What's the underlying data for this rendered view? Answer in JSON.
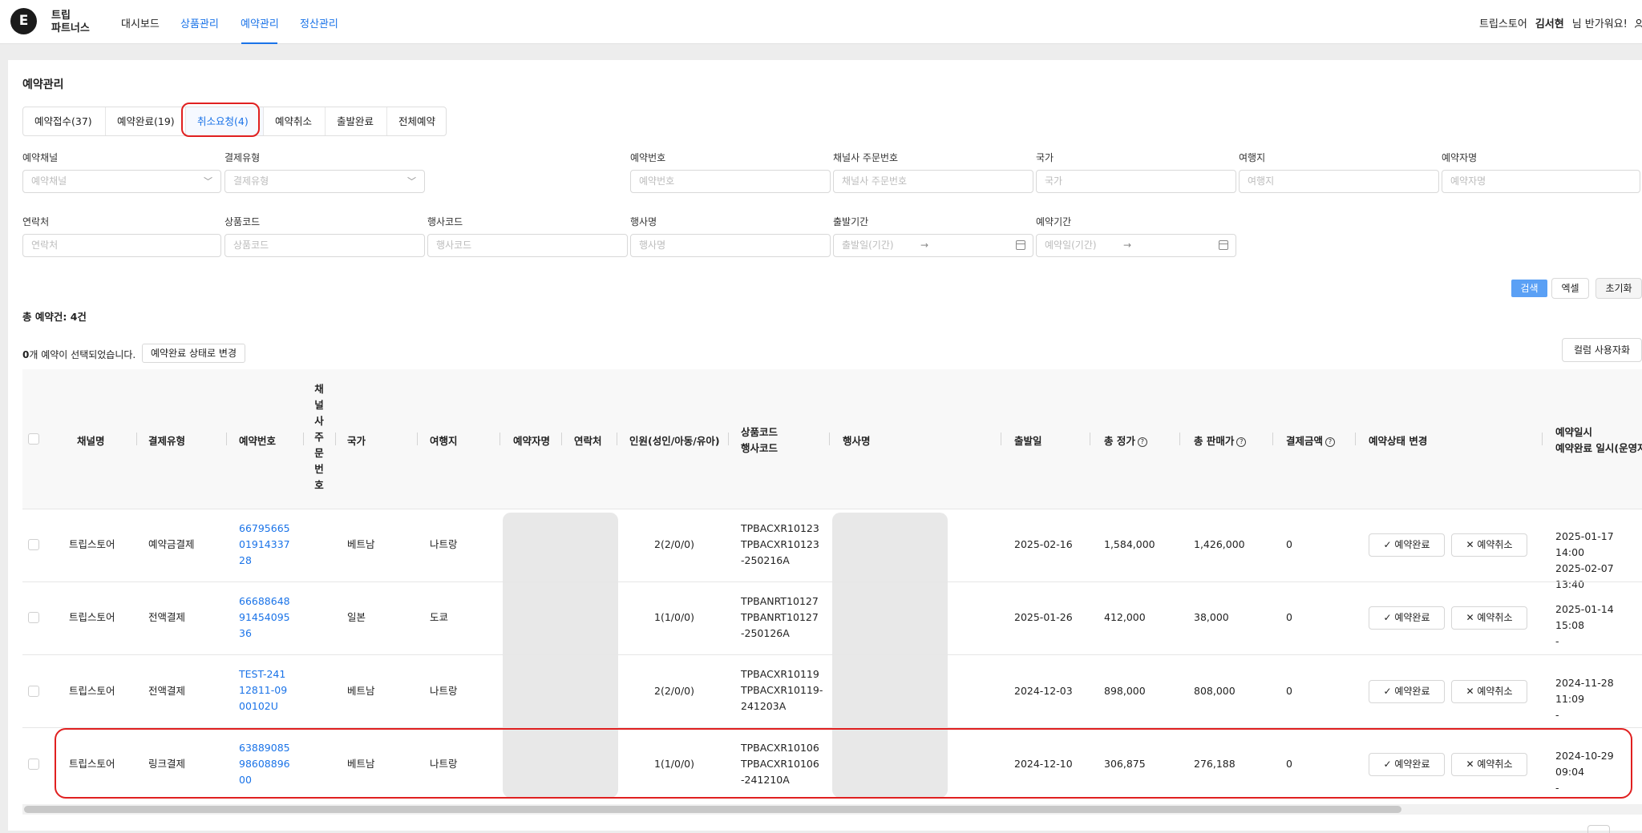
{
  "header": {
    "logo_letter": "E",
    "brand_line1": "트립",
    "brand_line2": "파트너스",
    "nav": [
      "대시보드",
      "상품관리",
      "예약관리",
      "정산관리"
    ],
    "store": "트립스토어",
    "user_name": "김서현",
    "greeting": "님 반가워요!"
  },
  "page": {
    "title": "예약관리",
    "tabs": [
      "예약접수(37)",
      "예약완료(19)",
      "취소요청(4)",
      "예약취소",
      "출발완료",
      "전체예약"
    ]
  },
  "filters": {
    "row1": [
      {
        "label": "예약채널",
        "placeholder": "예약채널"
      },
      {
        "label": "결제유형",
        "placeholder": "결제유형"
      },
      {
        "label": "예약번호",
        "placeholder": "예약번호"
      },
      {
        "label": "채널사 주문번호",
        "placeholder": "채널사 주문번호"
      },
      {
        "label": "국가",
        "placeholder": "국가"
      },
      {
        "label": "여행지",
        "placeholder": "여행지"
      },
      {
        "label": "예약자명",
        "placeholder": "예약자명"
      }
    ],
    "row2": [
      {
        "label": "연락처",
        "placeholder": "연락처"
      },
      {
        "label": "상품코드",
        "placeholder": "상품코드"
      },
      {
        "label": "행사코드",
        "placeholder": "행사코드"
      },
      {
        "label": "행사명",
        "placeholder": "행사명"
      },
      {
        "label": "출발기간",
        "placeholder": "출발일(기간)"
      },
      {
        "label": "예약기간",
        "placeholder": "예약일(기간)"
      }
    ],
    "date_arrow": "→",
    "search": "검색",
    "excel": "엑셀",
    "reset": "초기화"
  },
  "summary": {
    "total": "총 예약건: 4건",
    "selected_count": "0",
    "selected_text": "개 예약이 선택되었습니다.",
    "change_status": "예약완료  상태로 변경",
    "column_custom": "컬럼 사용자화"
  },
  "table": {
    "headers": {
      "channel": "채널명",
      "payment": "결제유형",
      "booking_no": "예약번호",
      "channel_order_no": "채널사주문번호",
      "country": "국가",
      "destination": "여행지",
      "booker": "예약자명",
      "contact": "연락처",
      "people": "인원(성인/아동/유아)",
      "product_code": "상품코드",
      "event_code": "행사코드",
      "event_name": "행사명",
      "departure": "출발일",
      "total_price": "총 정가",
      "total_sale": "총 판매가",
      "pay_amount": "결제금액",
      "status_change": "예약상태 변경",
      "booking_date": "예약일시",
      "complete_date": "예약완료 일시(운영자"
    },
    "confirm_label": "예약완료",
    "cancel_label": "예약취소",
    "rows": [
      {
        "channel": "트립스토어",
        "payment": "예약금결제",
        "booking_no": "6679566501914337 28",
        "country": "베트남",
        "destination": "나트랑",
        "people": "2(2/0/0)",
        "code1": "TPBACXR10123",
        "code2": "TPBACXR10123",
        "code3": "-250216A",
        "departure": "2025-02-16",
        "total_price": "1,584,000",
        "total_sale": "1,426,000",
        "pay_amount": "0",
        "date1": "2025-01-17 14:00",
        "date2": "2025-02-07 13:40"
      },
      {
        "channel": "트립스토어",
        "payment": "전액결제",
        "booking_no": "6668864891454095 36",
        "country": "일본",
        "destination": "도쿄",
        "people": "1(1/0/0)",
        "code1": "TPBANRT10127",
        "code2": "TPBANRT10127",
        "code3": "-250126A",
        "departure": "2025-01-26",
        "total_price": "412,000",
        "total_sale": "38,000",
        "pay_amount": "0",
        "date1": "2025-01-14 15:08",
        "date2": "-"
      },
      {
        "channel": "트립스토어",
        "payment": "전액결제",
        "booking_no": "TEST-24112811-0900102U",
        "country": "베트남",
        "destination": "나트랑",
        "people": "2(2/0/0)",
        "code1": "TPBACXR10119",
        "code2": "TPBACXR10119-",
        "code3": "241203A",
        "departure": "2024-12-03",
        "total_price": "898,000",
        "total_sale": "808,000",
        "pay_amount": "0",
        "date1": "2024-11-28 11:09",
        "date2": "-"
      },
      {
        "channel": "트립스토어",
        "payment": "링크결제",
        "booking_no": "6388908598608896 00",
        "country": "베트남",
        "destination": "나트랑",
        "people": "1(1/0/0)",
        "code1": "TPBACXR10106",
        "code2": "TPBACXR10106",
        "code3": "-241210A",
        "departure": "2024-12-10",
        "total_price": "306,875",
        "total_sale": "276,188",
        "pay_amount": "0",
        "date1": "2024-10-29 09:04",
        "date2": "-"
      }
    ]
  },
  "colors": {
    "accent": "#1a73e8",
    "highlight": "#e02020",
    "search_button": "#5aa0f5"
  }
}
